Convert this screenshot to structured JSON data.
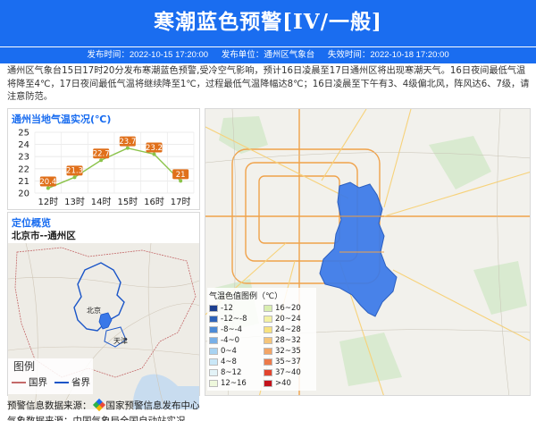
{
  "header": {
    "title": "寒潮蓝色预警[IV/一般]",
    "publish_time": "发布时间：2022-10-15 17:20:00",
    "publisher": "发布单位：通州区气象台",
    "expire_time": "失效时间：2022-10-18 17:20:00"
  },
  "description": "通州区气象台15日17时20分发布寒潮蓝色预警,受冷空气影响，预计16日凌晨至17日通州区将出现寒潮天气。16日夜间最低气温将降至4℃，17日夜间最低气温将继续降至1℃，过程最低气温降幅达8℃；16日凌晨至下午有3、4级偏北风，阵风达6、7级，请注意防范。",
  "temp_panel": {
    "title": "通州当地气温实况(℃)"
  },
  "chart_data": {
    "type": "line",
    "title": "通州当地气温实况(℃)",
    "categories": [
      "12时",
      "13时",
      "14时",
      "15时",
      "16时",
      "17时"
    ],
    "values": [
      20.4,
      21.3,
      22.7,
      23.7,
      23.2,
      21
    ],
    "data_labels": [
      "20.4",
      "21.3",
      "22.7",
      "23.7",
      "23.2",
      "21"
    ],
    "y_ticks": [
      "25",
      "24",
      "23",
      "22",
      "21",
      "20"
    ],
    "ylim": [
      20,
      25
    ],
    "grid": true,
    "line_color": "#8bc34a",
    "label_color": "#e0701b"
  },
  "location_panel": {
    "title": "定位概览",
    "subtitle": "北京市--通州区",
    "beijing_label": "北京",
    "tianjin_label": "天津",
    "legend_title": "图例",
    "legend_country": "国界",
    "legend_province": "省界"
  },
  "map_panel": {
    "legend_title": "气温色值图例（℃）",
    "legend_items": [
      {
        "label": "-12",
        "color": "#1d3f8f"
      },
      {
        "label": "16~20",
        "color": "#d9eeb0"
      },
      {
        "label": "-12~-8",
        "color": "#2e62b8"
      },
      {
        "label": "20~24",
        "color": "#f3f1a3"
      },
      {
        "label": "-8~-4",
        "color": "#4c8ad6"
      },
      {
        "label": "24~28",
        "color": "#f7e27f"
      },
      {
        "label": "-4~0",
        "color": "#78b0e8"
      },
      {
        "label": "28~32",
        "color": "#f5c57a"
      },
      {
        "label": "0~4",
        "color": "#a8d3f2"
      },
      {
        "label": "32~35",
        "color": "#f3a566"
      },
      {
        "label": "4~8",
        "color": "#c9e7f7"
      },
      {
        "label": "35~37",
        "color": "#ec7a4a"
      },
      {
        "label": "8~12",
        "color": "#e3f3f7"
      },
      {
        "label": "37~40",
        "color": "#e2452e"
      },
      {
        "label": "12~16",
        "color": "#eef8dc"
      },
      {
        "label": ">40",
        "color": "#c3121a"
      }
    ]
  },
  "footer": {
    "source_line": "预警信息数据来源：",
    "source_name": "国家预警信息发布中心",
    "obs_line": "气象数据来源：中国气象局全国自动站实况"
  },
  "colors": {
    "brand": "#1a6df0",
    "region_fill": "#3a78e8",
    "province_line": "#1a55c8",
    "country_line": "#c46a6a"
  }
}
